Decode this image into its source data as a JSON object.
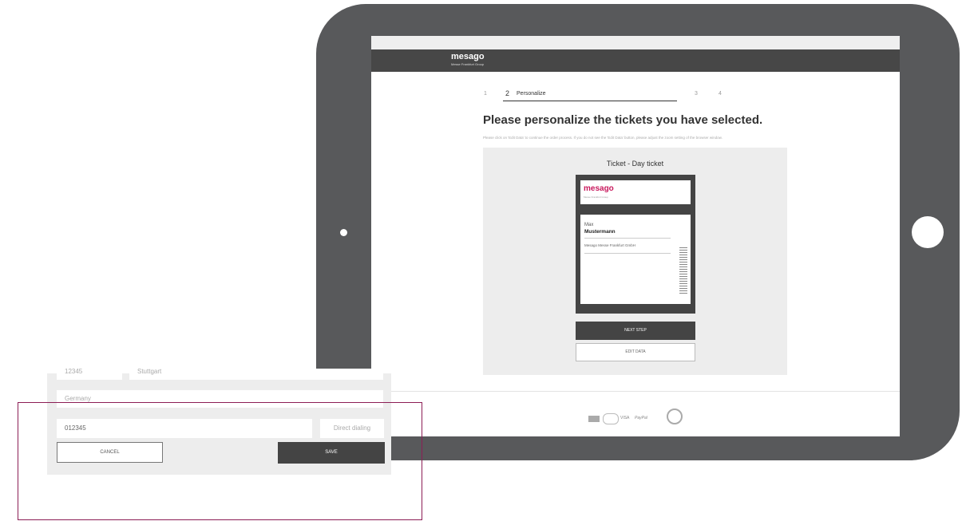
{
  "brand": {
    "logo": "mesago",
    "logo_sub": "Messe Frankfurt Group"
  },
  "steps": [
    {
      "number": "1",
      "label": ""
    },
    {
      "number": "2",
      "label": "Personalize"
    },
    {
      "number": "3",
      "label": ""
    },
    {
      "number": "4",
      "label": ""
    }
  ],
  "page": {
    "title": "Please personalize the tickets you have selected.",
    "note": "Please click on 'Edit Data' to continue the order process. If you do not see the 'Edit Data' button, please adjust the zoom setting of the browser window."
  },
  "ticket": {
    "title": "Ticket - Day ticket",
    "logo": "mesago",
    "logo_sub": "Messe Frankfurt Group",
    "first_name": "Max",
    "last_name": "Mustermann",
    "company": "Mesago Messe Frankfurt GmbH"
  },
  "buttons": {
    "next_step": "NEXT STEP",
    "edit_data": "EDIT DATA"
  },
  "payment": {
    "visa": "VISA",
    "paypal": "PayPal"
  },
  "form": {
    "zip": "12345",
    "city": "Stuttgart",
    "country": "Germany",
    "phone": "012345",
    "dial_placeholder": "Direct dialing",
    "cancel": "CANCEL",
    "save": "SAVE"
  },
  "colors": {
    "tablet": "#58595b",
    "header": "#474747",
    "accent": "#c8185c",
    "frame": "#8c1e55"
  }
}
